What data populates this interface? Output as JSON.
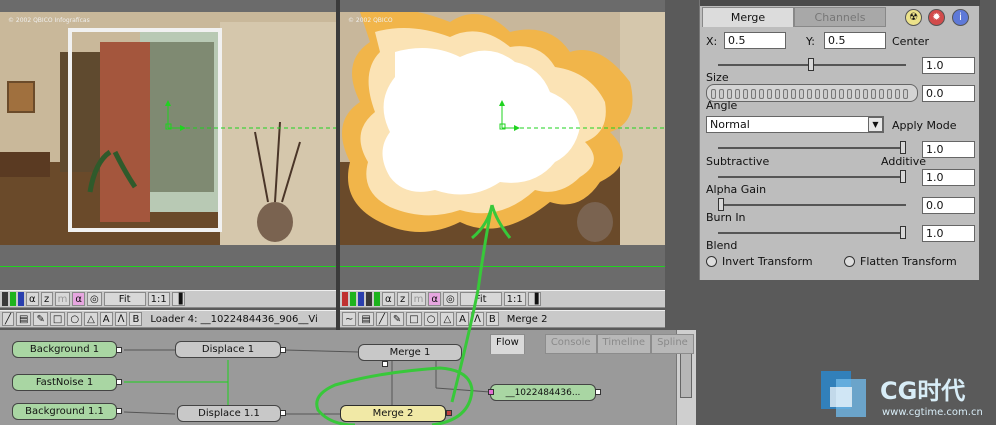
{
  "left_viewer": {
    "copyright": "© 2002 QBICO Infografícas"
  },
  "right_viewer": {
    "copyright": "© 2002 QBICO"
  },
  "left_toolbar": {
    "alpha": "α",
    "z": "z",
    "m": "m",
    "alpha2": "α",
    "fit": "Fit",
    "ratio": "1:1",
    "A": "A",
    "B": "B",
    "status": "Loader 4: __1022484436_906__Vi"
  },
  "right_toolbar": {
    "alpha": "α",
    "z": "z",
    "m": "m",
    "alpha2": "α",
    "fit": "Fit",
    "ratio": "1:1",
    "A": "A",
    "B": "B",
    "status": "Merge 2"
  },
  "flow": {
    "tabs": [
      "Flow",
      "Console",
      "Timeline",
      "Spline"
    ],
    "nodes": {
      "bg1": "Background 1",
      "fastnoise": "FastNoise 1",
      "bg11": "Background 1.1",
      "disp1": "Displace 1",
      "disp11": "Displace 1.1",
      "merge1": "Merge 1",
      "merge2": "Merge 2",
      "loader": "__1022484436..."
    }
  },
  "panel": {
    "title": "Merge 2",
    "tabs": [
      "Merge",
      "Channels"
    ],
    "x_label": "X:",
    "x_value": "0.5",
    "y_label": "Y:",
    "y_value": "0.5",
    "center_label": "Center",
    "size_label": "Size",
    "size_value": "1.0",
    "angle_label": "Angle",
    "angle_value": "0.0",
    "apply_mode": "Normal",
    "apply_mode_label": "Apply Mode",
    "subtractive_label": "Subtractive",
    "additive_label": "Additive",
    "sub_add_value": "1.0",
    "alpha_gain_label": "Alpha Gain",
    "alpha_gain_value": "1.0",
    "burn_in_label": "Burn In",
    "burn_in_value": "0.0",
    "blend_label": "Blend",
    "blend_value": "1.0",
    "invert_transform": "Invert Transform",
    "flatten_transform": "Flatten Transform",
    "center_slider": 0.5,
    "sub_add_slider": 1.0,
    "alpha_gain_slider": 1.0,
    "burn_in_slider": 0.0,
    "blend_slider": 1.0
  },
  "logo": {
    "text": "CG时代",
    "url": "www.cgtime.com.cn"
  }
}
